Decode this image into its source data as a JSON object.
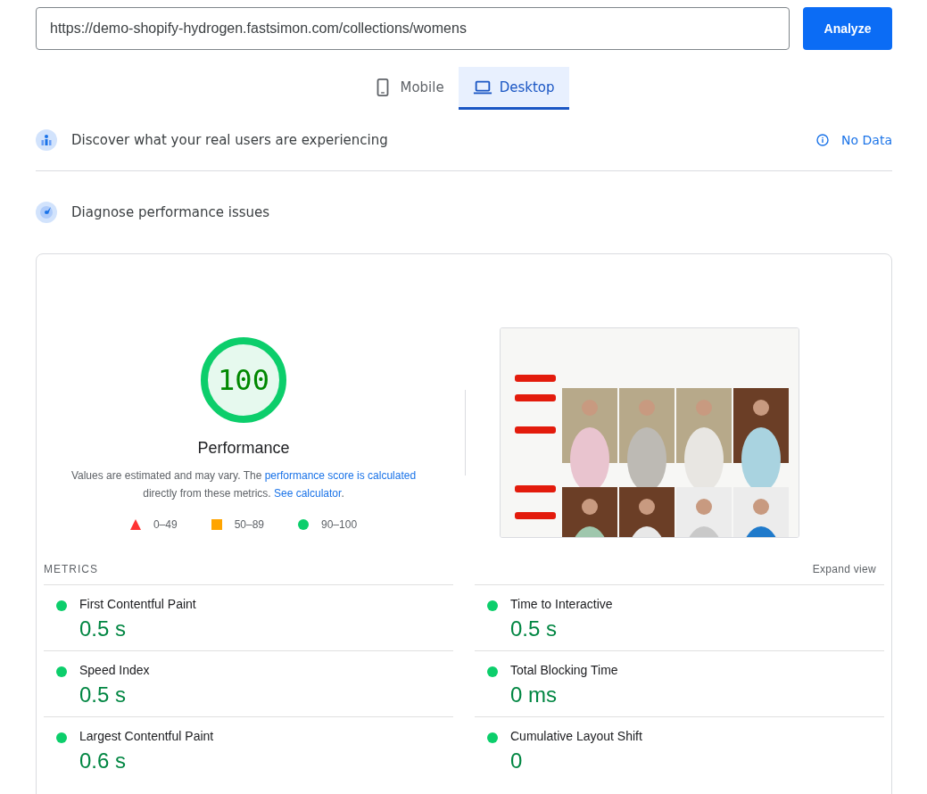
{
  "url_field": {
    "value": "https://demo-shopify-hydrogen.fastsimon.com/collections/womens"
  },
  "analyze_button": "Analyze",
  "tabs": [
    {
      "label": "Mobile",
      "kind": "mobile",
      "selected": false
    },
    {
      "label": "Desktop",
      "kind": "desktop",
      "selected": true
    }
  ],
  "field_data": {
    "title": "Discover what your real users are experiencing",
    "status": "No Data"
  },
  "lab_data": {
    "title": "Diagnose performance issues"
  },
  "performance": {
    "score": "100",
    "level": 1,
    "label": "Performance",
    "description": {
      "before": "Values are estimated and may vary. The ",
      "link": "performance score is calculated",
      "middle": " directly from these metrics. ",
      "link2": "See calculator",
      "after": "."
    },
    "legend": [
      {
        "kind": "fail",
        "label": "0–49"
      },
      {
        "kind": "average",
        "label": "50–89"
      },
      {
        "kind": "pass",
        "label": "90–100"
      }
    ]
  },
  "metrics": {
    "title": "METRICS",
    "expand": "Expand view",
    "items": [
      {
        "name": "First Contentful Paint",
        "value": "0.5 s",
        "color": "#0cce6b"
      },
      {
        "name": "Time to Interactive",
        "value": "0.5 s",
        "color": "#0cce6b"
      },
      {
        "name": "Speed Index",
        "value": "0.5 s",
        "color": "#0cce6b"
      },
      {
        "name": "Total Blocking Time",
        "value": "0 ms",
        "color": "#0cce6b"
      },
      {
        "name": "Largest Contentful Paint",
        "value": "0.6 s",
        "color": "#0cce6b"
      },
      {
        "name": "Cumulative Layout Shift",
        "value": "0",
        "color": "#0cce6b"
      }
    ]
  }
}
